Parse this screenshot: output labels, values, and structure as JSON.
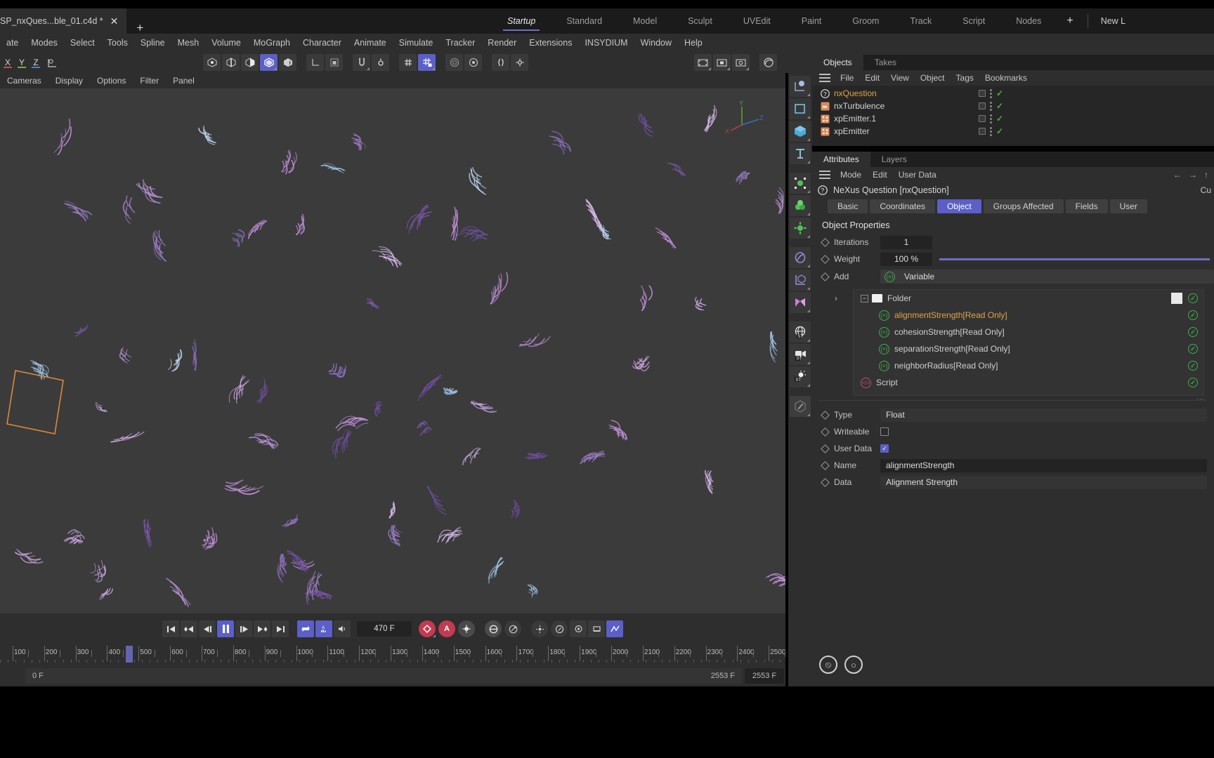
{
  "window": {
    "document_tab": "SP_nxQues...ble_01.c4d *",
    "close_label": "✕",
    "new_tab_label": "+"
  },
  "layouts": {
    "items": [
      "Startup",
      "Standard",
      "Model",
      "Sculpt",
      "UVEdit",
      "Paint",
      "Groom",
      "Track",
      "Script",
      "Nodes"
    ],
    "active": "Startup",
    "add_label": "+",
    "new_layout_label": "New L"
  },
  "menubar": {
    "items": [
      "ate",
      "Modes",
      "Select",
      "Tools",
      "Spline",
      "Mesh",
      "Volume",
      "MoGraph",
      "Character",
      "Animate",
      "Simulate",
      "Tracker",
      "Render",
      "Extensions",
      "INSYDIUM",
      "Window",
      "Help"
    ]
  },
  "toolbar": {
    "axes": [
      "X",
      "Y",
      "Z"
    ],
    "axis_extra_icon": "world-axis-icon",
    "groups": [
      [
        "point-mode-icon",
        "edge-mode-icon",
        "polygon-mode-icon",
        "model-mode-icon",
        "texture-mode-icon"
      ],
      [
        "axis-mode-icon",
        "object-mode-icon"
      ],
      [
        "enable-snap-icon",
        "snap-settings-icon"
      ],
      [
        "grid-icon",
        "grid-lock-icon"
      ],
      [
        "workplane-icon",
        "workplane-settings-icon"
      ],
      [
        "mirror-icon",
        "mirror-settings-icon"
      ]
    ],
    "right_group": [
      "render-view-icon",
      "render-region-icon",
      "render-settings-icon",
      "material-preview-icon"
    ],
    "active_mode": "model-mode-icon",
    "active_snap": "grid-lock-icon"
  },
  "viewport": {
    "menu": [
      "Cameras",
      "Display",
      "Options",
      "Filter",
      "Panel"
    ],
    "corner_icons": [
      "pan-icon",
      "dolly-icon",
      "rotate-icon",
      "maximize-icon"
    ],
    "axis_gizmo": {
      "x": "X",
      "y": "Y",
      "z": "Z"
    },
    "background": "#3b3b3b"
  },
  "transport": {
    "buttons": [
      "go-to-start-icon",
      "prev-key-icon",
      "prev-frame-icon",
      "play-pause-icon",
      "next-frame-icon",
      "next-key-icon",
      "go-to-end-icon"
    ],
    "active_button": "play-pause-icon",
    "loop_icon": "loop-icon",
    "autokey-mode-icon": "animation-mode-icon",
    "sound_icon": "sound-icon",
    "current_frame": "470 F",
    "record_buttons": [
      "record-active-objects-icon",
      "autokeying-icon",
      "keyframe-selection-icon"
    ],
    "param_buttons": [
      "position-key-icon",
      "scale-key-icon",
      "rotation-key-icon",
      "pla-key-icon"
    ],
    "right_buttons": [
      "param-level-icon",
      "point-level-icon",
      "obj-key-icon",
      "motion-key-icon"
    ],
    "timeline_icon": "timeline-curve-icon"
  },
  "ruler": {
    "ticks": [
      100,
      200,
      300,
      400,
      500,
      600,
      700,
      800,
      900,
      1000,
      1100,
      1200,
      1300,
      1400,
      1500,
      1600,
      1700,
      1800,
      1900,
      2000,
      2100,
      2200,
      2300,
      2400,
      2500
    ],
    "playhead_frame": 470,
    "min": 60,
    "max": 2553
  },
  "status": {
    "left_value": "0 F",
    "right_value": "2553 F",
    "end_value": "2553 F"
  },
  "rail": {
    "items": [
      "null-object-icon",
      "spline-pen-icon",
      "cube-primitive-icon",
      "text-spline-icon",
      "mograph-cloner-icon",
      "mograph-effector-icon",
      "simulate-icon",
      "deformer-icon",
      "scene-axis-icon",
      "field-icon",
      "environment-icon",
      "camera-icon",
      "light-icon",
      "material-edit-icon"
    ]
  },
  "object_manager": {
    "tabs": [
      "Objects",
      "Takes"
    ],
    "active_tab": "Objects",
    "menu": [
      "File",
      "Edit",
      "View",
      "Object",
      "Tags",
      "Bookmarks"
    ],
    "rows": [
      {
        "name": "nxQuestion",
        "icon": "nexus-question-icon",
        "selected": true,
        "enabled": true
      },
      {
        "name": "nxTurbulence",
        "icon": "nexus-turbulence-icon",
        "selected": false,
        "enabled": true
      },
      {
        "name": "xpEmitter.1",
        "icon": "xp-emitter-icon",
        "selected": false,
        "enabled": true
      },
      {
        "name": "xpEmitter",
        "icon": "xp-emitter-icon",
        "selected": false,
        "enabled": true
      }
    ]
  },
  "attribute_manager": {
    "tabs": [
      "Attributes",
      "Layers"
    ],
    "active_tab": "Attributes",
    "menu": [
      "Mode",
      "Edit",
      "User Data"
    ],
    "nav_icons": [
      "back-arrow-icon",
      "forward-arrow-icon",
      "up-arrow-icon"
    ],
    "object_title": "NeXus Question [nxQuestion]",
    "object_icon": "nexus-question-icon",
    "tab_row": [
      "Basic",
      "Coordinates",
      "Object",
      "Groups Affected",
      "Fields",
      "User"
    ],
    "active_tab_row": "Object",
    "cursor_tooltip": "Cu",
    "section_title": "Object Properties",
    "properties": {
      "iterations_label": "Iterations",
      "iterations_value": "1",
      "weight_label": "Weight",
      "weight_value": "100 %",
      "add_label": "Add",
      "add_value": "Variable"
    },
    "tree": [
      {
        "label": "Folder",
        "icon": "folder-icon",
        "indent": 0,
        "highlight": false,
        "has_checkbox": true,
        "has_swatch": true
      },
      {
        "label": "alignmentStrength[Read Only]",
        "icon": "variable-icon",
        "indent": 1,
        "highlight": true,
        "has_checkbox": true,
        "has_swatch": false
      },
      {
        "label": "cohesionStrength[Read Only]",
        "icon": "variable-icon",
        "indent": 1,
        "highlight": false,
        "has_checkbox": true,
        "has_swatch": false
      },
      {
        "label": "separationStrength[Read Only]",
        "icon": "variable-icon",
        "indent": 1,
        "highlight": false,
        "has_checkbox": true,
        "has_swatch": false
      },
      {
        "label": "neighborRadius[Read Only]",
        "icon": "variable-icon",
        "indent": 1,
        "highlight": false,
        "has_checkbox": true,
        "has_swatch": false
      },
      {
        "label": "Script",
        "icon": "script-icon",
        "indent": 0,
        "highlight": false,
        "has_checkbox": true,
        "has_swatch": false
      }
    ],
    "detail": {
      "type_label": "Type",
      "type_value": "Float",
      "writeable_label": "Writeable",
      "writeable_checked": false,
      "userdata_label": "User Data",
      "userdata_checked": true,
      "name_label": "Name",
      "name_value": "alignmentStrength",
      "data_label": "Data",
      "data_value": "Alignment Strength"
    }
  },
  "footer_logos": [
    "insydium-logo",
    "xparticles-logo"
  ],
  "colors": {
    "accent": "#5b5fc7",
    "panel": "#2e2e2e",
    "panel_dark": "#262626",
    "field": "#232323",
    "text": "#c8c8c8",
    "highlight_orange": "#e0a44a",
    "green": "#3fae4a",
    "red": "#c0506a"
  }
}
